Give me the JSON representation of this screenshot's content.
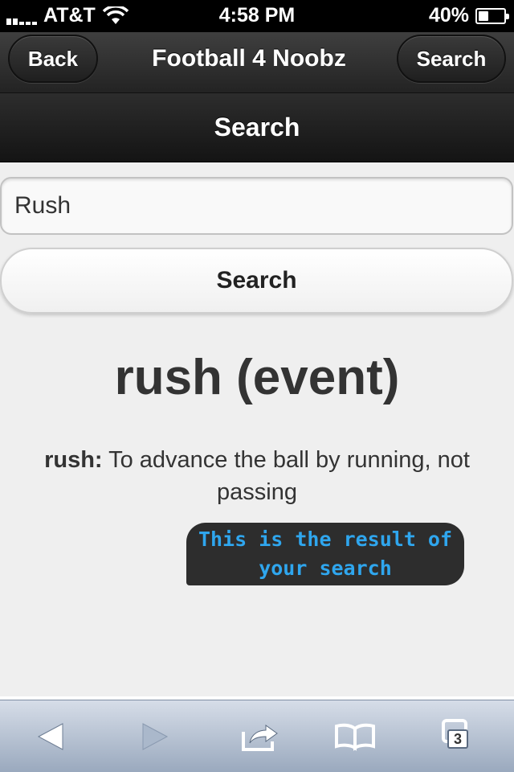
{
  "status_bar": {
    "carrier": "AT&T",
    "time": "4:58 PM",
    "battery_percent": "40%",
    "battery_level": 0.4
  },
  "nav_bar": {
    "back_label": "Back",
    "title": "Football 4 Noobz",
    "search_label": "Search"
  },
  "page": {
    "header_title": "Search"
  },
  "search": {
    "input_value": "Rush",
    "button_label": "Search"
  },
  "result": {
    "title": "rush (event)",
    "term": "rush:",
    "definition": " To advance the ball by running, not passing",
    "tooltip": "This is the result of your search"
  },
  "toolbar": {
    "tabs_count": "3",
    "icons": [
      "back-arrow-icon",
      "forward-arrow-icon",
      "share-icon",
      "bookmarks-icon",
      "tabs-icon"
    ]
  },
  "colors": {
    "tooltip_text": "#2fa6ee",
    "tooltip_bg": "#2d2d2d",
    "header_bg": "#232323"
  }
}
